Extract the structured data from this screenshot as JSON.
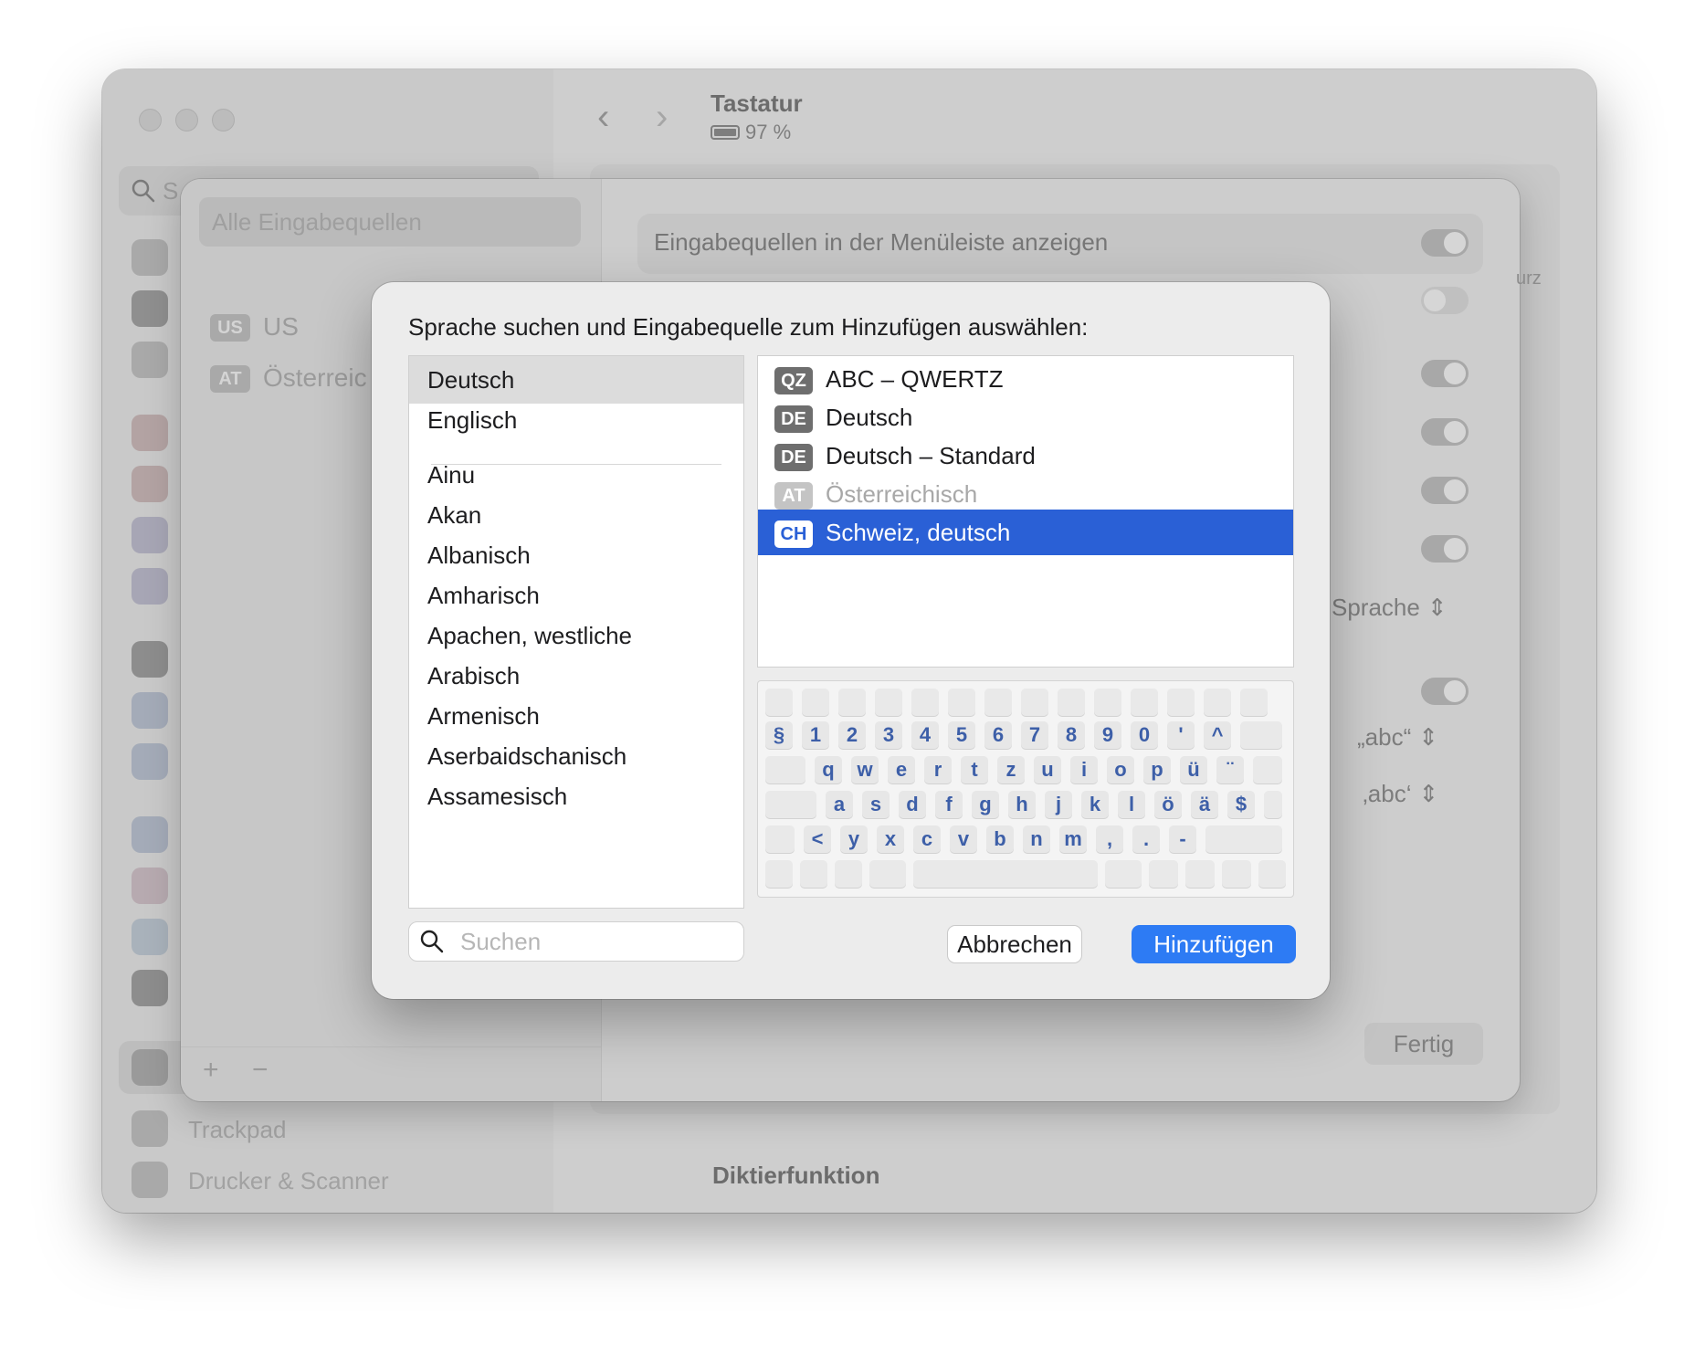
{
  "window": {
    "title": "Tastatur",
    "battery": "97 %",
    "section_dictation": "Diktierfunktion"
  },
  "sidebar": {
    "search_placeholder": "S",
    "items": [
      {
        "label": "Trackpad",
        "icon": "trackpad-icon"
      },
      {
        "label": "Drucker & Scanner",
        "icon": "printer-icon"
      }
    ]
  },
  "sheet": {
    "filter_label": "Alle Eingabequellen",
    "sources": [
      {
        "tag": "US",
        "label": "US"
      },
      {
        "tag": "AT",
        "label": "Österreic"
      }
    ],
    "add_symbol": "+",
    "remove_symbol": "−",
    "show_in_menubar_label": "Eingabequellen in der Menüleiste anzeigen",
    "sprache_label": "Sprache",
    "quote_double": "„abc“",
    "quote_single": "‚abc‘",
    "fragment_urz": "urz",
    "done_label": "Fertig"
  },
  "dialog": {
    "prompt": "Sprache suchen und Eingabequelle zum Hinzufügen auswählen:",
    "languages_top": [
      "Deutsch",
      "Englisch"
    ],
    "languages": [
      "Ainu",
      "Akan",
      "Albanisch",
      "Amharisch",
      "Apachen, westliche",
      "Arabisch",
      "Armenisch",
      "Aserbaidschanisch",
      "Assamesisch"
    ],
    "selected_language": "Deutsch",
    "input_sources": [
      {
        "tag": "QZ",
        "label": "ABC – QWERTZ",
        "state": "normal"
      },
      {
        "tag": "DE",
        "label": "Deutsch",
        "state": "normal"
      },
      {
        "tag": "DE",
        "label": "Deutsch – Standard",
        "state": "normal"
      },
      {
        "tag": "AT",
        "label": "Österreichisch",
        "state": "disabled"
      },
      {
        "tag": "CH",
        "label": "Schweiz, deutsch",
        "state": "selected"
      }
    ],
    "keyboard_rows": [
      [
        "§",
        "1",
        "2",
        "3",
        "4",
        "5",
        "6",
        "7",
        "8",
        "9",
        "0",
        "'",
        "^"
      ],
      [
        "q",
        "w",
        "e",
        "r",
        "t",
        "z",
        "u",
        "i",
        "o",
        "p",
        "ü",
        "¨"
      ],
      [
        "a",
        "s",
        "d",
        "f",
        "g",
        "h",
        "j",
        "k",
        "l",
        "ö",
        "ä",
        "$"
      ],
      [
        "<",
        "y",
        "x",
        "c",
        "v",
        "b",
        "n",
        "m",
        ",",
        ".",
        "-"
      ]
    ],
    "search_placeholder": "Suchen",
    "cancel_label": "Abbrechen",
    "add_label": "Hinzufügen"
  },
  "colors": {
    "accent": "#2d7bf4",
    "selection": "#2a60d6",
    "key_text": "#3d5fa8"
  }
}
